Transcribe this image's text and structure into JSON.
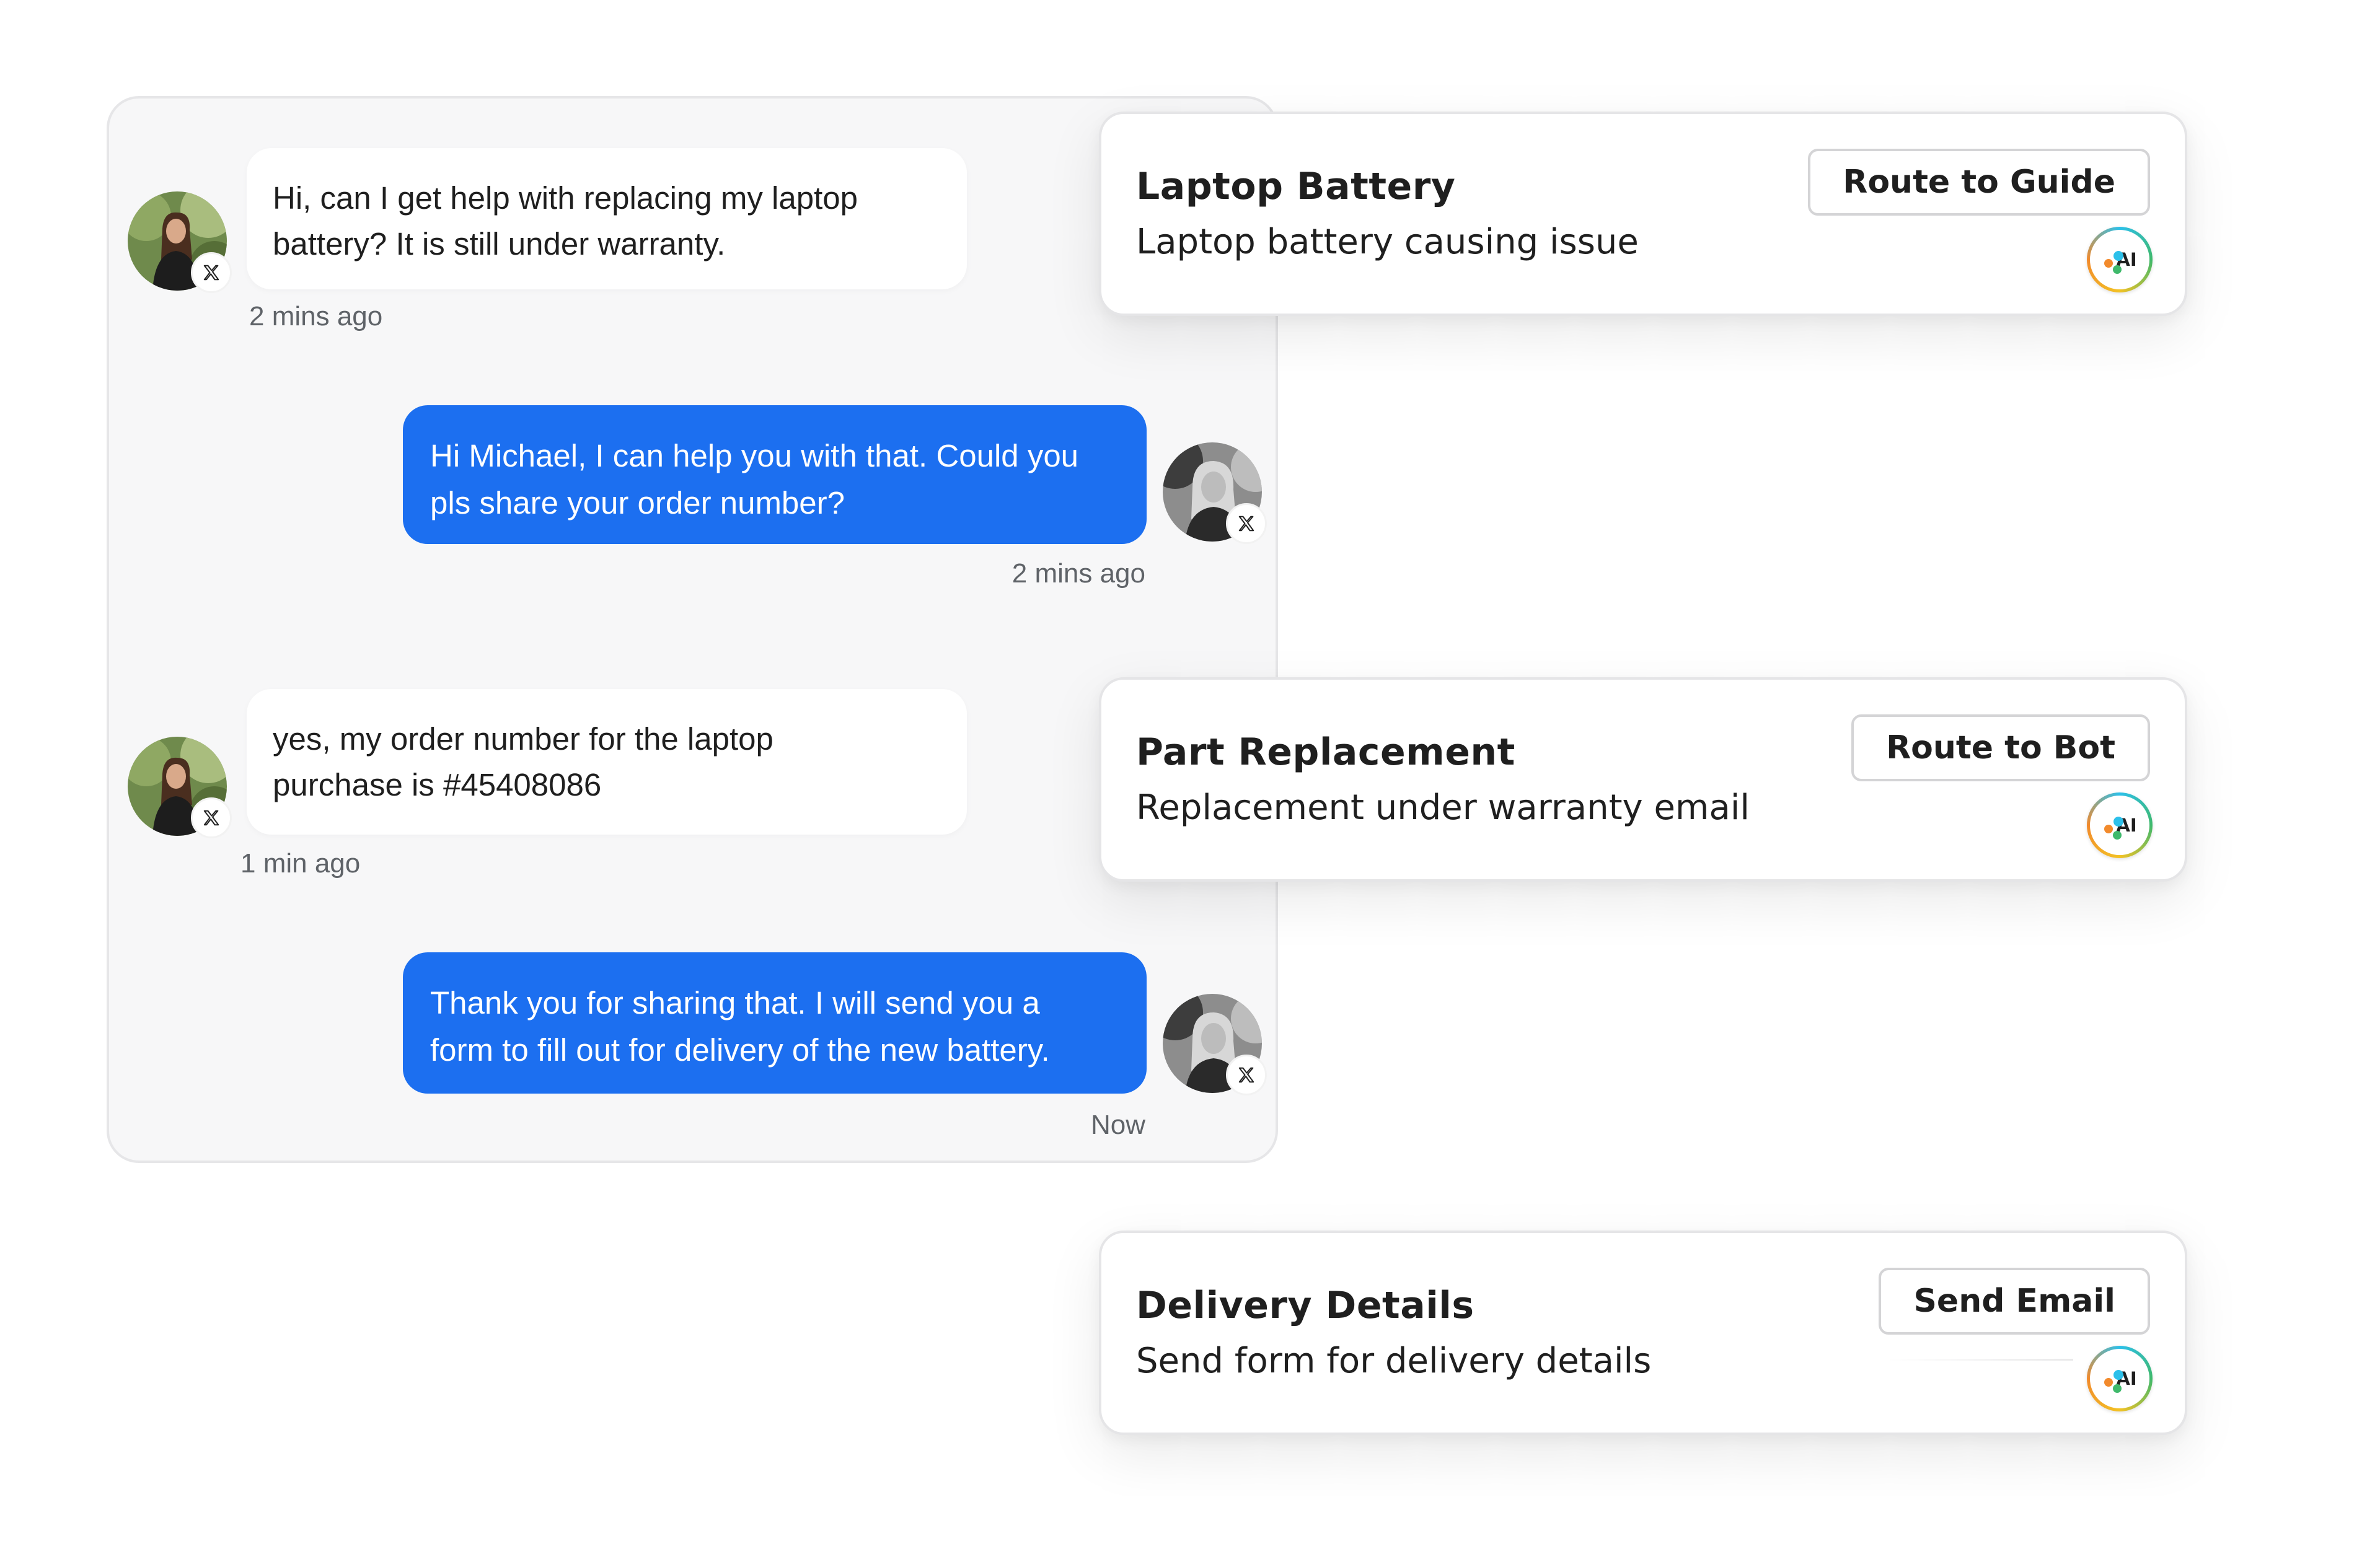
{
  "chat": {
    "messages": [
      {
        "direction": "incoming",
        "text": "Hi, can I get help with replacing my laptop\nbattery? It is still under warranty.",
        "time": "2 mins ago",
        "channel_icon": "x-logo-icon"
      },
      {
        "direction": "outgoing",
        "text": "Hi Michael, I can help you with that. Could you\npls share your order number?",
        "time": "2 mins ago",
        "channel_icon": "x-logo-icon"
      },
      {
        "direction": "incoming",
        "text": "yes, my order number for the laptop\npurchase is #45408086",
        "time": "1 min ago",
        "channel_icon": "x-logo-icon"
      },
      {
        "direction": "outgoing",
        "text": "Thank you for sharing that. I will send you a\nform to fill out for delivery of the new battery.",
        "time": "Now",
        "channel_icon": "x-logo-icon"
      }
    ]
  },
  "cards": [
    {
      "title": "Laptop Battery",
      "subtitle": "Laptop battery causing issue",
      "button": "Route to Guide",
      "badge": "AI"
    },
    {
      "title": "Part Replacement",
      "subtitle": "Replacement under warranty email",
      "button": "Route to Bot",
      "badge": "AI"
    },
    {
      "title": "Delivery Details",
      "subtitle": "Send form for delivery details",
      "button": "Send Email",
      "badge": "AI"
    }
  ],
  "colors": {
    "outgoing_bubble": "#1c6ff0",
    "incoming_bubble": "#ffffff",
    "panel_bg": "#f7f7f8"
  }
}
